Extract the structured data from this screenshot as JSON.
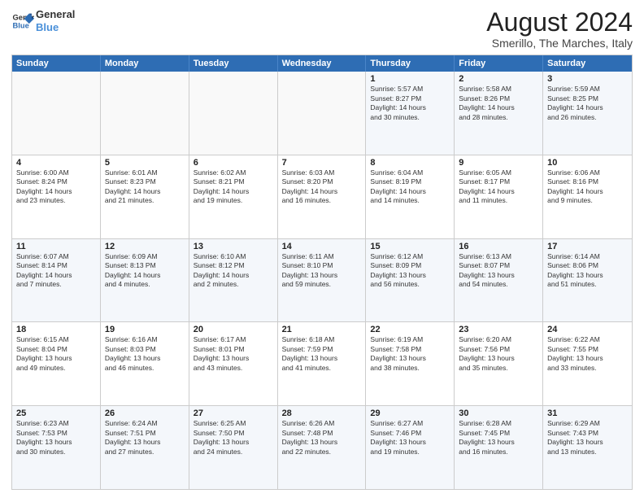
{
  "logo": {
    "line1": "General",
    "line2": "Blue"
  },
  "title": "August 2024",
  "subtitle": "Smerillo, The Marches, Italy",
  "days": [
    "Sunday",
    "Monday",
    "Tuesday",
    "Wednesday",
    "Thursday",
    "Friday",
    "Saturday"
  ],
  "weeks": [
    [
      {
        "day": "",
        "text": ""
      },
      {
        "day": "",
        "text": ""
      },
      {
        "day": "",
        "text": ""
      },
      {
        "day": "",
        "text": ""
      },
      {
        "day": "1",
        "text": "Sunrise: 5:57 AM\nSunset: 8:27 PM\nDaylight: 14 hours\nand 30 minutes."
      },
      {
        "day": "2",
        "text": "Sunrise: 5:58 AM\nSunset: 8:26 PM\nDaylight: 14 hours\nand 28 minutes."
      },
      {
        "day": "3",
        "text": "Sunrise: 5:59 AM\nSunset: 8:25 PM\nDaylight: 14 hours\nand 26 minutes."
      }
    ],
    [
      {
        "day": "4",
        "text": "Sunrise: 6:00 AM\nSunset: 8:24 PM\nDaylight: 14 hours\nand 23 minutes."
      },
      {
        "day": "5",
        "text": "Sunrise: 6:01 AM\nSunset: 8:23 PM\nDaylight: 14 hours\nand 21 minutes."
      },
      {
        "day": "6",
        "text": "Sunrise: 6:02 AM\nSunset: 8:21 PM\nDaylight: 14 hours\nand 19 minutes."
      },
      {
        "day": "7",
        "text": "Sunrise: 6:03 AM\nSunset: 8:20 PM\nDaylight: 14 hours\nand 16 minutes."
      },
      {
        "day": "8",
        "text": "Sunrise: 6:04 AM\nSunset: 8:19 PM\nDaylight: 14 hours\nand 14 minutes."
      },
      {
        "day": "9",
        "text": "Sunrise: 6:05 AM\nSunset: 8:17 PM\nDaylight: 14 hours\nand 11 minutes."
      },
      {
        "day": "10",
        "text": "Sunrise: 6:06 AM\nSunset: 8:16 PM\nDaylight: 14 hours\nand 9 minutes."
      }
    ],
    [
      {
        "day": "11",
        "text": "Sunrise: 6:07 AM\nSunset: 8:14 PM\nDaylight: 14 hours\nand 7 minutes."
      },
      {
        "day": "12",
        "text": "Sunrise: 6:09 AM\nSunset: 8:13 PM\nDaylight: 14 hours\nand 4 minutes."
      },
      {
        "day": "13",
        "text": "Sunrise: 6:10 AM\nSunset: 8:12 PM\nDaylight: 14 hours\nand 2 minutes."
      },
      {
        "day": "14",
        "text": "Sunrise: 6:11 AM\nSunset: 8:10 PM\nDaylight: 13 hours\nand 59 minutes."
      },
      {
        "day": "15",
        "text": "Sunrise: 6:12 AM\nSunset: 8:09 PM\nDaylight: 13 hours\nand 56 minutes."
      },
      {
        "day": "16",
        "text": "Sunrise: 6:13 AM\nSunset: 8:07 PM\nDaylight: 13 hours\nand 54 minutes."
      },
      {
        "day": "17",
        "text": "Sunrise: 6:14 AM\nSunset: 8:06 PM\nDaylight: 13 hours\nand 51 minutes."
      }
    ],
    [
      {
        "day": "18",
        "text": "Sunrise: 6:15 AM\nSunset: 8:04 PM\nDaylight: 13 hours\nand 49 minutes."
      },
      {
        "day": "19",
        "text": "Sunrise: 6:16 AM\nSunset: 8:03 PM\nDaylight: 13 hours\nand 46 minutes."
      },
      {
        "day": "20",
        "text": "Sunrise: 6:17 AM\nSunset: 8:01 PM\nDaylight: 13 hours\nand 43 minutes."
      },
      {
        "day": "21",
        "text": "Sunrise: 6:18 AM\nSunset: 7:59 PM\nDaylight: 13 hours\nand 41 minutes."
      },
      {
        "day": "22",
        "text": "Sunrise: 6:19 AM\nSunset: 7:58 PM\nDaylight: 13 hours\nand 38 minutes."
      },
      {
        "day": "23",
        "text": "Sunrise: 6:20 AM\nSunset: 7:56 PM\nDaylight: 13 hours\nand 35 minutes."
      },
      {
        "day": "24",
        "text": "Sunrise: 6:22 AM\nSunset: 7:55 PM\nDaylight: 13 hours\nand 33 minutes."
      }
    ],
    [
      {
        "day": "25",
        "text": "Sunrise: 6:23 AM\nSunset: 7:53 PM\nDaylight: 13 hours\nand 30 minutes."
      },
      {
        "day": "26",
        "text": "Sunrise: 6:24 AM\nSunset: 7:51 PM\nDaylight: 13 hours\nand 27 minutes."
      },
      {
        "day": "27",
        "text": "Sunrise: 6:25 AM\nSunset: 7:50 PM\nDaylight: 13 hours\nand 24 minutes."
      },
      {
        "day": "28",
        "text": "Sunrise: 6:26 AM\nSunset: 7:48 PM\nDaylight: 13 hours\nand 22 minutes."
      },
      {
        "day": "29",
        "text": "Sunrise: 6:27 AM\nSunset: 7:46 PM\nDaylight: 13 hours\nand 19 minutes."
      },
      {
        "day": "30",
        "text": "Sunrise: 6:28 AM\nSunset: 7:45 PM\nDaylight: 13 hours\nand 16 minutes."
      },
      {
        "day": "31",
        "text": "Sunrise: 6:29 AM\nSunset: 7:43 PM\nDaylight: 13 hours\nand 13 minutes."
      }
    ]
  ]
}
